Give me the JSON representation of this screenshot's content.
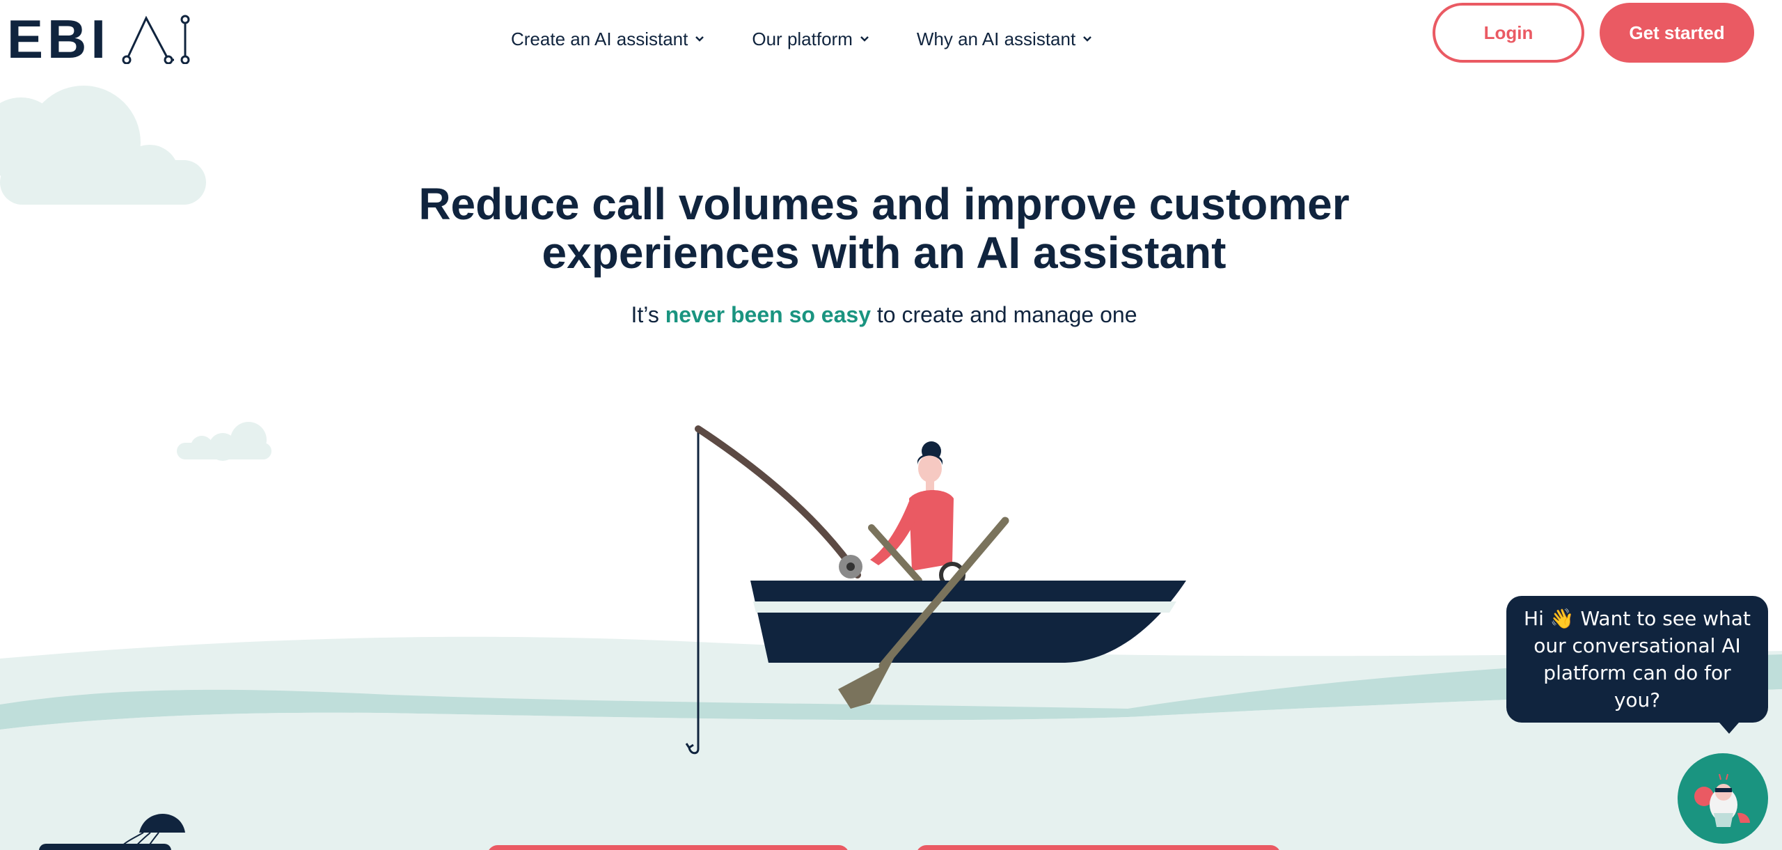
{
  "brand": {
    "logo_text": "EBI"
  },
  "nav": {
    "items": [
      {
        "label": "Create an AI assistant"
      },
      {
        "label": "Our platform"
      },
      {
        "label": "Why an AI assistant"
      }
    ]
  },
  "header": {
    "login_label": "Login",
    "get_started_label": "Get started"
  },
  "hero": {
    "title_line1": "Reduce call volumes and improve customer",
    "title_line2": "experiences with an AI assistant",
    "subtitle_pre": "It’s",
    "subtitle_accent": "never been so easy",
    "subtitle_post": "to create and manage one"
  },
  "chat": {
    "greeting_line1": "Hi 👋 Want to see what",
    "greeting_line2": "our conversational AI",
    "greeting_line3": "platform can do for you?"
  },
  "colors": {
    "navy": "#10243e",
    "coral": "#ea5a63",
    "teal": "#1a9480",
    "sea_light": "#e6f1ef",
    "sea_mid": "#bfdeda"
  }
}
